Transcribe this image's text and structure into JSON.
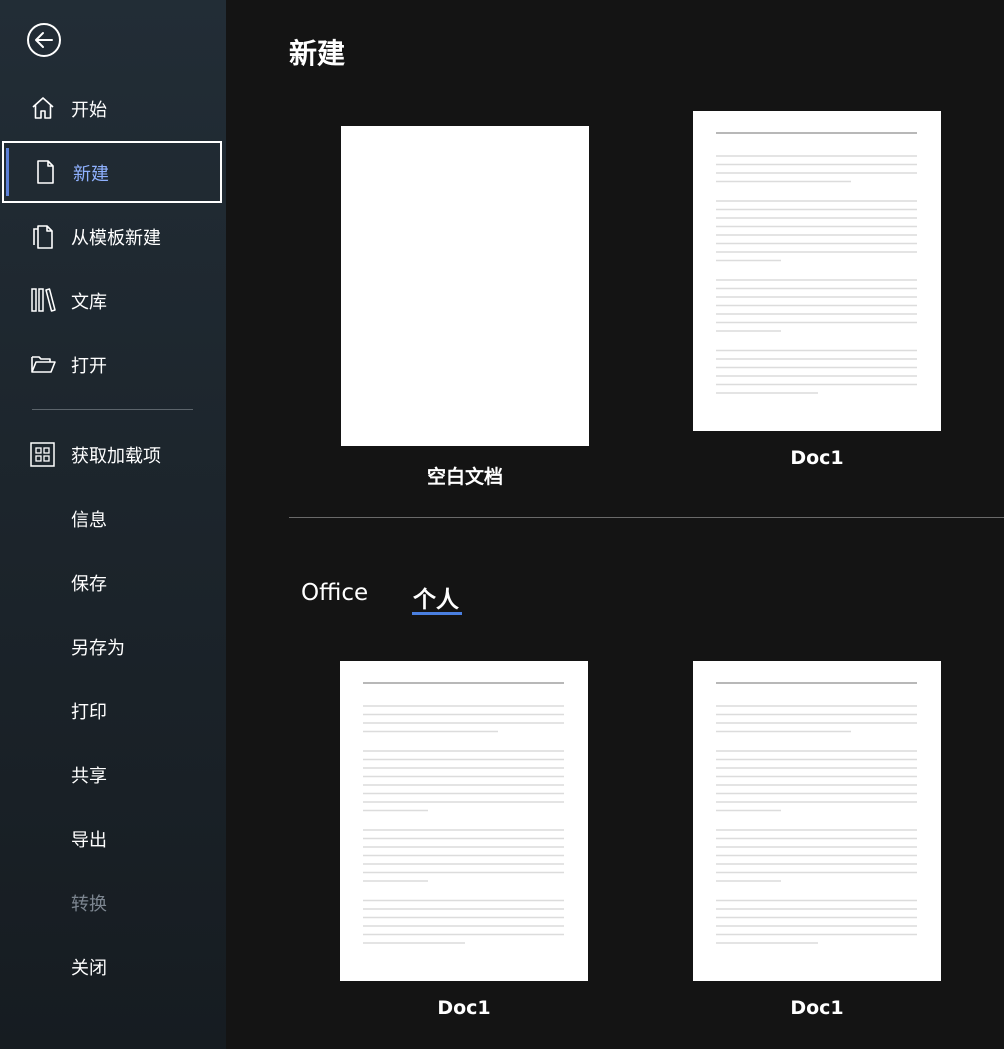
{
  "sidebar": {
    "back_icon": "back-arrow-icon",
    "items": [
      {
        "id": "home",
        "label": "开始",
        "icon": "home-icon"
      },
      {
        "id": "new",
        "label": "新建",
        "icon": "new-document-icon",
        "active": true
      },
      {
        "id": "from-template",
        "label": "从模板新建",
        "icon": "templates-icon"
      },
      {
        "id": "library",
        "label": "文库",
        "icon": "library-icon"
      },
      {
        "id": "open",
        "label": "打开",
        "icon": "folder-open-icon"
      },
      {
        "id": "addins",
        "label": "获取加载项",
        "icon": "grid-icon"
      },
      {
        "id": "info",
        "label": "信息"
      },
      {
        "id": "save",
        "label": "保存"
      },
      {
        "id": "save-as",
        "label": "另存为"
      },
      {
        "id": "print",
        "label": "打印"
      },
      {
        "id": "share",
        "label": "共享"
      },
      {
        "id": "export",
        "label": "导出"
      },
      {
        "id": "convert",
        "label": "转换",
        "disabled": true
      },
      {
        "id": "close",
        "label": "关闭"
      }
    ],
    "accent_color": "#5b7fd6",
    "active_label_color": "#8fb1ff"
  },
  "main": {
    "title": "新建",
    "templates_top": [
      {
        "label": "空白文档",
        "kind": "blank"
      },
      {
        "label": "Doc1",
        "kind": "lined"
      }
    ],
    "tabs": [
      {
        "label": "Office",
        "active": false
      },
      {
        "label": "个人",
        "active": true
      }
    ],
    "tab_accent_color": "#4a7fe0",
    "templates_personal": [
      {
        "label": "Doc1",
        "kind": "lined"
      },
      {
        "label": "Doc1",
        "kind": "lined"
      }
    ]
  }
}
